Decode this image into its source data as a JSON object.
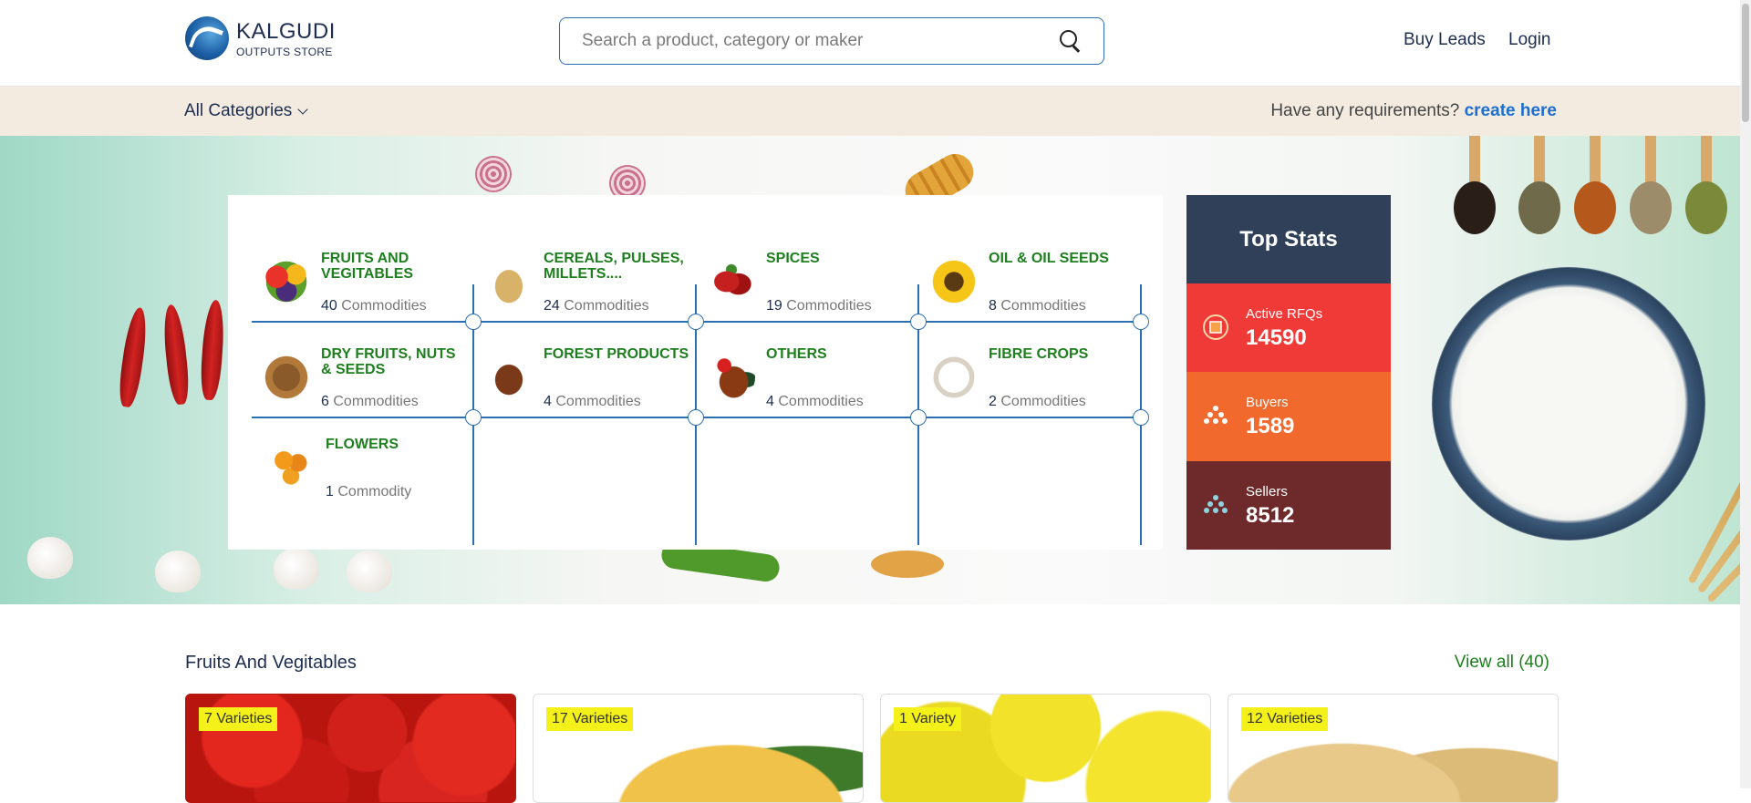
{
  "header": {
    "logo_name": "KALGUDI",
    "logo_sub": "OUTPUTS STORE",
    "search_placeholder": "Search a product, category or maker",
    "buy_leads": "Buy Leads",
    "login": "Login"
  },
  "catbar": {
    "all_categories": "All Categories",
    "requirement_text": "Have any requirements?",
    "create_link": "create here"
  },
  "categories": [
    {
      "name": "FRUITS AND VEGITABLES",
      "count": "40",
      "unit": "Commodities",
      "icon": "fruits-icon"
    },
    {
      "name": "CEREALS, PULSES, MILLETS....",
      "count": "24",
      "unit": "Commodities",
      "icon": "cereals-icon"
    },
    {
      "name": "SPICES",
      "count": "19",
      "unit": "Commodities",
      "icon": "spices-icon"
    },
    {
      "name": "OIL & OIL SEEDS",
      "count": "8",
      "unit": "Commodities",
      "icon": "sunflower-icon"
    },
    {
      "name": "DRY FRUITS, NUTS & SEEDS",
      "count": "6",
      "unit": "Commodities",
      "icon": "dry-fruits-icon"
    },
    {
      "name": "FOREST PRODUCTS",
      "count": "4",
      "unit": "Commodities",
      "icon": "forest-products-icon"
    },
    {
      "name": "OTHERS",
      "count": "4",
      "unit": "Commodities",
      "icon": "rooster-icon"
    },
    {
      "name": "FIBRE CROPS",
      "count": "2",
      "unit": "Commodities",
      "icon": "cotton-icon"
    },
    {
      "name": "FLOWERS",
      "count": "1",
      "unit": "Commodity",
      "icon": "flowers-icon"
    }
  ],
  "stats": {
    "title": "Top Stats",
    "items": [
      {
        "label": "Active RFQs",
        "value": "14590",
        "color": "#f03a38",
        "icon": "rfq-icon"
      },
      {
        "label": "Buyers",
        "value": "1589",
        "color": "#f2692e",
        "icon": "buyers-icon"
      },
      {
        "label": "Sellers",
        "value": "8512",
        "color": "#6e2a2a",
        "icon": "sellers-icon"
      }
    ]
  },
  "section": {
    "title": "Fruits And Vegitables",
    "view_all": "View all (40)",
    "cards": [
      {
        "badge": "7 Varieties",
        "image": "tomatoes"
      },
      {
        "badge": "17 Varieties",
        "image": "mango"
      },
      {
        "badge": "1 Variety",
        "image": "lemons"
      },
      {
        "badge": "12 Varieties",
        "image": "potatoes"
      }
    ]
  },
  "colors": {
    "primary": "#1d2d50",
    "accent_blue": "#2c6fb3",
    "category_green": "#1e7f1e",
    "link_blue": "#1c6fd1",
    "badge_yellow": "#f4f01a"
  }
}
